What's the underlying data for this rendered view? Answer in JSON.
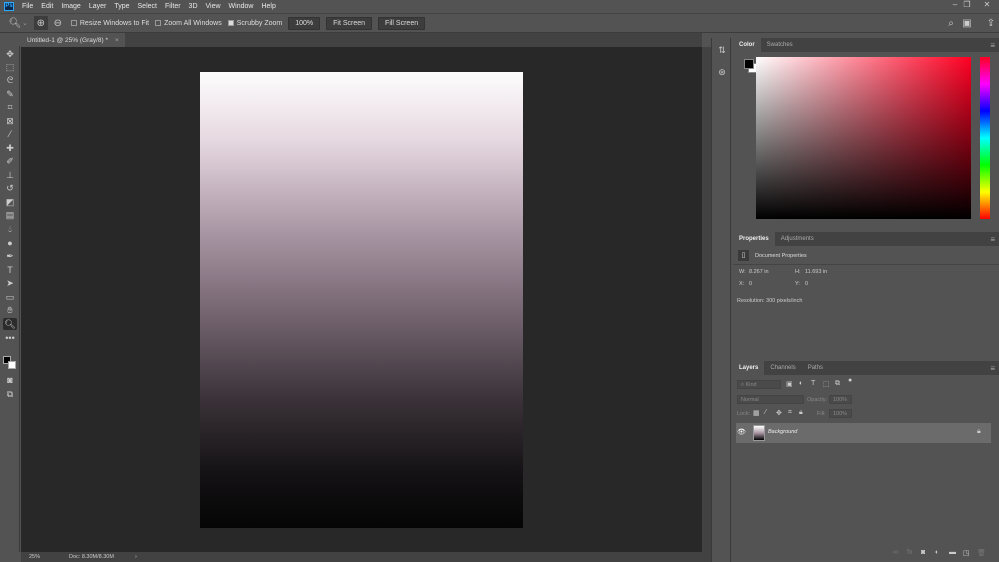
{
  "app": {
    "logo": "Ps"
  },
  "menu": [
    "File",
    "Edit",
    "Image",
    "Layer",
    "Type",
    "Select",
    "Filter",
    "3D",
    "View",
    "Window",
    "Help"
  ],
  "window_controls": {
    "minimize": "–",
    "restore": "❐",
    "close": "✕"
  },
  "options_bar": {
    "resize_windows": "Resize Windows to Fit",
    "zoom_all": "Zoom All Windows",
    "scrubby_zoom": "Scrubby Zoom",
    "zoom_value": "100%",
    "fit_screen": "Fit Screen",
    "fill_screen": "Fill Screen"
  },
  "document_tab": {
    "title": "Untitled-1 @ 25% (Gray/8) *",
    "close": "×"
  },
  "status": {
    "zoom": "25%",
    "doc": "Doc: 8.30M/8.30M",
    "arrow": "›"
  },
  "color_panel": {
    "tabs": [
      "Color",
      "Swatches"
    ],
    "foreground": "#000000",
    "background": "#ffffff"
  },
  "properties_panel": {
    "tabs": [
      "Properties",
      "Adjustments"
    ],
    "heading": "Document Properties",
    "w_label": "W:",
    "w": "8.267 in",
    "h_label": "H:",
    "h": "11.693 in",
    "x_label": "X:",
    "x": "0",
    "y_label": "Y:",
    "y": "0",
    "resolution": "Resolution: 300 pixels/inch"
  },
  "layers_panel": {
    "tabs": [
      "Layers",
      "Channels",
      "Paths"
    ],
    "filter_placeholder": "Kind",
    "blend_mode": "Normal",
    "opacity_label": "Opacity:",
    "opacity": "100%",
    "lock_label": "Lock:",
    "fill_label": "Fill:",
    "fill": "100%",
    "layers": [
      {
        "name": "Background",
        "visible": true,
        "locked": true
      }
    ]
  }
}
